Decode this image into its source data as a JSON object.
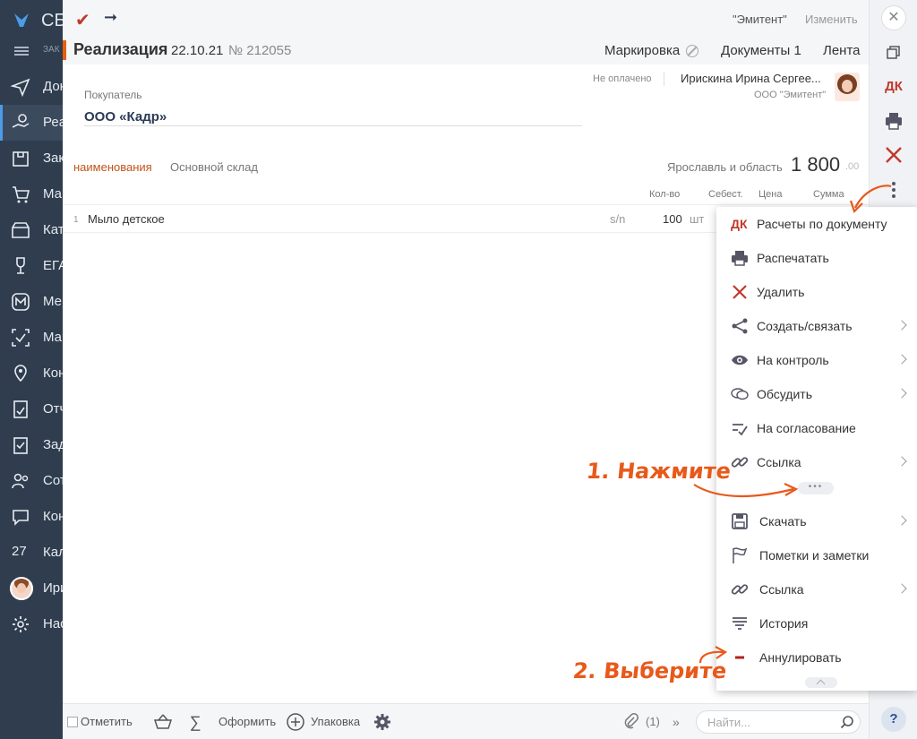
{
  "sidebar": {
    "brand": "СБ",
    "sub_label": "ЗАК",
    "items": [
      {
        "label": "Документы",
        "icon": "paper-plane-icon"
      },
      {
        "label": "Реализация",
        "icon": "hand-coins-icon"
      },
      {
        "label": "Закупки",
        "icon": "bag-icon"
      },
      {
        "label": "Магазин",
        "icon": "cart-icon"
      },
      {
        "label": "Каталог",
        "icon": "box-icon"
      },
      {
        "label": "ЕГАИС",
        "icon": "wine-glass-icon"
      },
      {
        "label": "Меркурий",
        "icon": "m-badge-icon"
      },
      {
        "label": "Маркировка",
        "icon": "check-frame-icon"
      },
      {
        "label": "Контрагенты",
        "icon": "location-icon"
      },
      {
        "label": "Отчеты",
        "icon": "report-icon"
      },
      {
        "label": "Задачи",
        "icon": "task-icon"
      },
      {
        "label": "Сотрудники",
        "icon": "people-icon"
      },
      {
        "label": "Контакты",
        "icon": "chat-icon"
      },
      {
        "label": "Календарь",
        "icon": "calendar-icon",
        "number": "27"
      },
      {
        "label": "Ирина",
        "icon": "user-avatar"
      },
      {
        "label": "Настройки",
        "icon": "gear-icon"
      }
    ]
  },
  "topbar": {
    "org": "\"Эмитент\"",
    "change": "Изменить"
  },
  "document": {
    "title": "Реализация",
    "date": "22.10.21",
    "number": "№ 212055",
    "links": {
      "marking": "Маркировка",
      "documents": "Документы 1",
      "feed": "Лента"
    },
    "payment_status": "Не оплачено",
    "responsible": "Ирискина Ирина Сергее...",
    "responsible_org": "ООО \"Эмитент\"",
    "buyer_label": "Покупатель",
    "buyer": "ООО «Кадр»",
    "tab": "наименования",
    "warehouse": "Основной склад",
    "region": "Ярославль и область",
    "total_int": "1 800",
    "total_dec": ".00"
  },
  "table": {
    "headers": {
      "qty": "Кол-во",
      "cost": "Себест.",
      "price": "Цена",
      "sum": "Сумма"
    },
    "rows": [
      {
        "index": "1",
        "name": "Мыло детское",
        "sn": "s/n",
        "qty": "100",
        "unit": "шт"
      }
    ]
  },
  "menu": {
    "items": [
      {
        "label": "Расчеты по документу",
        "icon": "dk-icon",
        "submenu": false
      },
      {
        "label": "Распечатать",
        "icon": "printer-icon",
        "submenu": false
      },
      {
        "label": "Удалить",
        "icon": "delete-x-icon",
        "submenu": false
      },
      {
        "label": "Создать/связать",
        "icon": "share-icon",
        "submenu": true
      },
      {
        "label": "На контроль",
        "icon": "eye-icon",
        "submenu": true
      },
      {
        "label": "Обсудить",
        "icon": "chat-bubbles-icon",
        "submenu": true
      },
      {
        "label": "На согласование",
        "icon": "approve-icon",
        "submenu": false
      },
      {
        "label": "Ссылка",
        "icon": "link-icon",
        "submenu": true
      },
      {
        "label": "Скачать",
        "icon": "floppy-icon",
        "submenu": true
      },
      {
        "label": "Пометки и заметки",
        "icon": "flag-icon",
        "submenu": false
      },
      {
        "label": "Ссылка",
        "icon": "link-icon",
        "submenu": true
      },
      {
        "label": "История",
        "icon": "history-icon",
        "submenu": false
      },
      {
        "label": "Аннулировать",
        "icon": "minus-icon",
        "submenu": false
      }
    ],
    "more": "•••"
  },
  "bottombar": {
    "mark": "Отметить",
    "sigma": "∑",
    "issue": "Оформить",
    "packing": "Упаковка",
    "attachments": "(1)",
    "search_placeholder": "Найти..."
  },
  "righttoolbar": {
    "dk": "ДК",
    "help": "?"
  },
  "annotations": {
    "step1": "1. Нажмите",
    "step2": "2. Выберите"
  },
  "colors": {
    "sidebar": "#2f3d4e",
    "accent_orange": "#e8591a",
    "danger_red": "#c0392b",
    "buyer_blue": "#2b3a55"
  }
}
